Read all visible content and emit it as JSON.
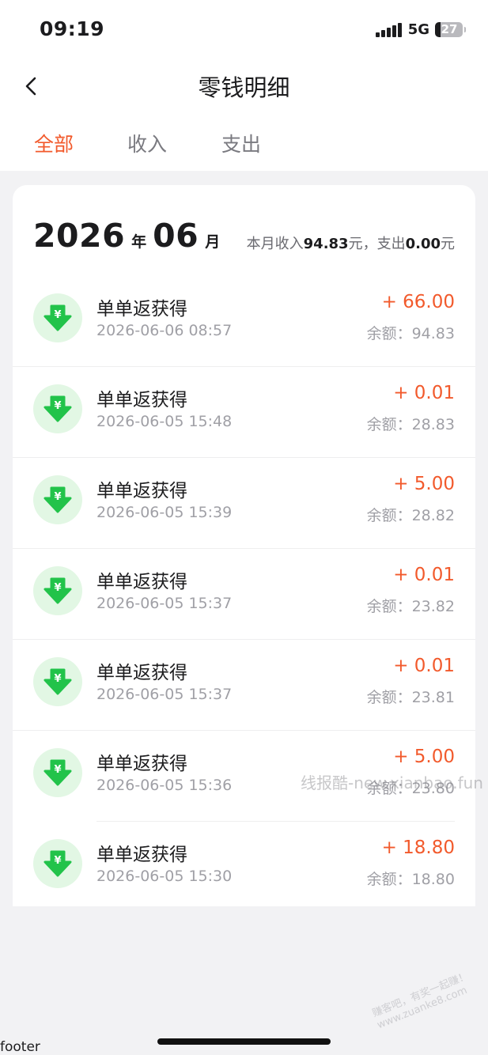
{
  "status_bar": {
    "time": "09:19",
    "network": "5G",
    "battery": "27"
  },
  "header": {
    "title": "零钱明细"
  },
  "tabs": [
    {
      "label": "全部",
      "active": true
    },
    {
      "label": "收入",
      "active": false
    },
    {
      "label": "支出",
      "active": false
    }
  ],
  "month": {
    "year": "2026",
    "year_unit": "年",
    "month": "06",
    "month_unit": "月",
    "income_prefix": "本月收入",
    "income": "94.83",
    "income_suffix": "元，支出",
    "expense": "0.00",
    "expense_suffix": "元"
  },
  "transactions": [
    {
      "name": "单单返获得",
      "time": "2026-06-06 08:57",
      "amount": "+ 66.00",
      "balance": "余额：94.83"
    },
    {
      "name": "单单返获得",
      "time": "2026-06-05 15:48",
      "amount": "+ 0.01",
      "balance": "余额：28.83"
    },
    {
      "name": "单单返获得",
      "time": "2026-06-05 15:39",
      "amount": "+ 5.00",
      "balance": "余额：28.82"
    },
    {
      "name": "单单返获得",
      "time": "2026-06-05 15:37",
      "amount": "+ 0.01",
      "balance": "余额：23.82"
    },
    {
      "name": "单单返获得",
      "time": "2026-06-05 15:37",
      "amount": "+ 0.01",
      "balance": "余额：23.81"
    },
    {
      "name": "单单返获得",
      "time": "2026-06-05 15:36",
      "amount": "+ 5.00",
      "balance": "余额：23.80"
    },
    {
      "name": "单单返获得",
      "time": "2026-06-05 15:30",
      "amount": "+ 18.80",
      "balance": "余额：18.80"
    }
  ],
  "watermark": "线报酷-new.xianbao.fun",
  "stamp": {
    "line1": "赚客吧，有奖一起赚！",
    "line2": "www.zuanke8.com"
  },
  "footer": "footer",
  "colors": {
    "accent": "#f25a2c",
    "income_icon_bg": "#e2f7e4",
    "income_icon": "#22c34a"
  },
  "icons": {
    "back": "chevron-left-icon",
    "transaction": "yuan-download-icon"
  }
}
